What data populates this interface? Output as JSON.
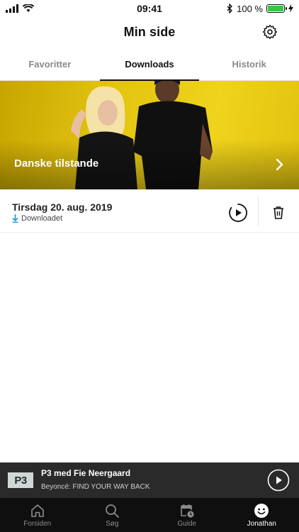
{
  "status_bar": {
    "time": "09:41",
    "battery": "100 %",
    "battery_level": 1.0
  },
  "header": {
    "title": "Min side",
    "settings_icon": "gear-icon"
  },
  "tabs": [
    {
      "label": "Favoritter",
      "active": false
    },
    {
      "label": "Downloads",
      "active": true
    },
    {
      "label": "Historik",
      "active": false
    }
  ],
  "banner": {
    "title": "Danske tilstande",
    "chevron_icon": "chevron-right-icon"
  },
  "episode": {
    "date": "Tirsdag 20. aug. 2019",
    "status": "Downloadet",
    "status_color": "#1e9ad6"
  },
  "player": {
    "logo": "P3",
    "title": "P3 med Fie Neergaard",
    "subtitle": "Beyoncé: FIND YOUR WAY BACK"
  },
  "tabbar": [
    {
      "label": "Forsiden",
      "icon": "home-icon",
      "active": false
    },
    {
      "label": "Søg",
      "icon": "search-icon",
      "active": false
    },
    {
      "label": "Guide",
      "icon": "calendar-clock-icon",
      "active": false
    },
    {
      "label": "Jonathan",
      "icon": "smiley-icon",
      "active": true
    }
  ],
  "colors": {
    "banner_yellow": "#e2c311",
    "player_bg": "#2a2a2a",
    "tabbar_bg": "#0f0f0f"
  }
}
